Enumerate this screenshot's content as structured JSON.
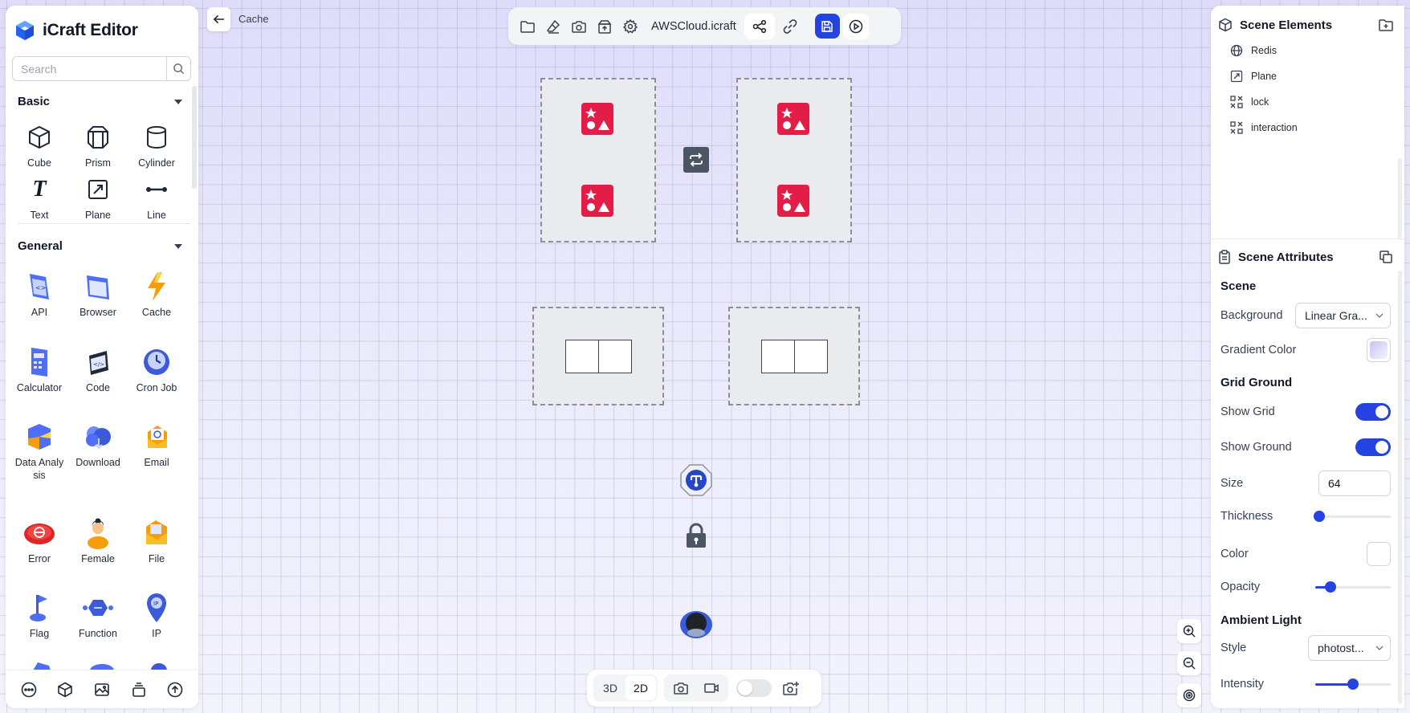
{
  "app": {
    "title": "iCraft Editor"
  },
  "search": {
    "placeholder": "Search"
  },
  "basic": {
    "title": "Basic",
    "items": [
      "Cube",
      "Prism",
      "Cylinder",
      "Text",
      "Plane",
      "Line"
    ]
  },
  "general": {
    "title": "General",
    "items": [
      "API",
      "Browser",
      "Cache",
      "Calculator",
      "Code",
      "Cron Job",
      "Data Analy sis",
      "Download",
      "Email",
      "Error",
      "Female",
      "File",
      "Flag",
      "Function",
      "IP"
    ]
  },
  "breadcrumb": {
    "back_label": "Cache"
  },
  "toolbar": {
    "file_name": "AWSCloud.icraft"
  },
  "scene_elements": {
    "title": "Scene Elements",
    "items": [
      {
        "label": "Redis",
        "icon": "globe-icon"
      },
      {
        "label": "Plane",
        "icon": "plane-icon"
      },
      {
        "label": "lock",
        "icon": "group-icon"
      },
      {
        "label": "interaction",
        "icon": "group-icon"
      }
    ]
  },
  "scene_attributes": {
    "title": "Scene Attributes",
    "scene_section": "Scene",
    "background_label": "Background",
    "background_value": "Linear Gra...",
    "gradient_color_label": "Gradient Color",
    "grid_ground_section": "Grid Ground",
    "show_grid_label": "Show Grid",
    "show_grid": true,
    "show_ground_label": "Show Ground",
    "show_ground": true,
    "size_label": "Size",
    "size_value": "64",
    "thickness_label": "Thickness",
    "thickness": 0.05,
    "color_label": "Color",
    "opacity_label": "Opacity",
    "opacity": 0.2,
    "ambient_light_section": "Ambient Light",
    "style_label": "Style",
    "style_value": "photost...",
    "intensity_label": "Intensity",
    "intensity": 0.5
  },
  "view": {
    "mode_3d": "3D",
    "mode_2d": "2D",
    "active_mode": "2D"
  },
  "colors": {
    "accent": "#2443e0",
    "redis_red": "#e11d48",
    "gradient_top": "#dedcf9"
  }
}
